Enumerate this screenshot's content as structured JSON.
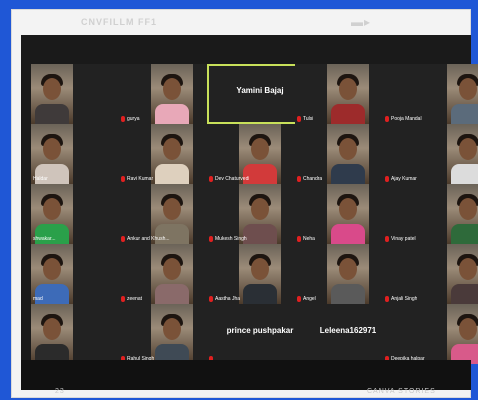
{
  "top_label": "CNVFILLM FF1",
  "bottom_left_label": "23",
  "bottom_right_label": "CANVA STORIES",
  "participants": [
    {
      "name": ""
    },
    {
      "name": "gurya"
    },
    {
      "name": "Yamini Bajaj"
    },
    {
      "name": "Tulsi"
    },
    {
      "name": "Pooja Mandal"
    },
    {
      "name": "Haldar"
    },
    {
      "name": "Ravi Kumar"
    },
    {
      "name": "Dev Chaturvedi"
    },
    {
      "name": "Chandra"
    },
    {
      "name": "Ajay Kumar"
    },
    {
      "name": "shwakar..."
    },
    {
      "name": "Ankur and Khush..."
    },
    {
      "name": "Mukesh Singh"
    },
    {
      "name": "Neha"
    },
    {
      "name": "Vinay patel"
    },
    {
      "name": "mad"
    },
    {
      "name": "zeenat"
    },
    {
      "name": "Aastha Jha"
    },
    {
      "name": "Angel"
    },
    {
      "name": "Anjali Singh"
    },
    {
      "name": ""
    },
    {
      "name": "Rahul Singh"
    },
    {
      "name": "prince pushpakar"
    },
    {
      "name": "Leleena162971"
    },
    {
      "name": "Deepika halpar"
    }
  ]
}
